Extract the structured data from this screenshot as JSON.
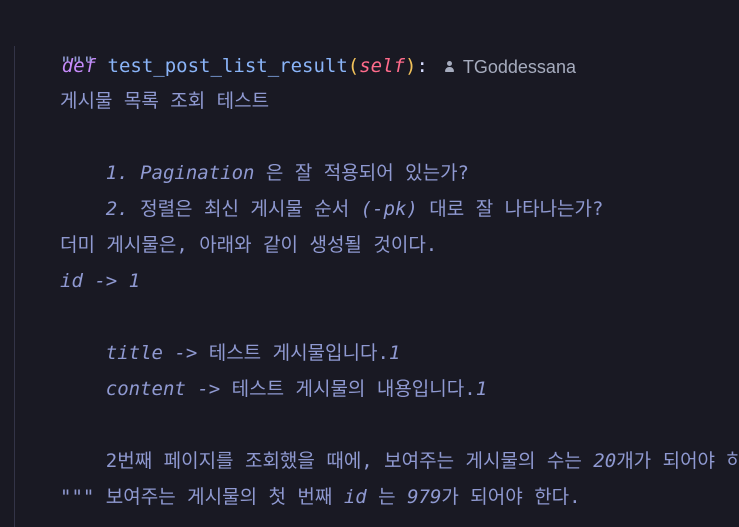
{
  "code": {
    "keyword": "def",
    "function_name": "test_post_list_result",
    "open_paren": "(",
    "param": "self",
    "close_paren": ")",
    "colon": ":",
    "author": "TGoddessana",
    "doc_open": "\"\"\"",
    "doc_title": "게시물 목록 조회 테스트",
    "doc_line1_prefix": "1. Pagination ",
    "doc_line1_rest": "은 잘 적용되어 있는가?",
    "doc_line2_prefix": "2. ",
    "doc_line2_mid": "정렬은 최신 게시물 순서 ",
    "doc_line2_pk": "(-pk) ",
    "doc_line2_end": "대로 잘 나타나는가?",
    "dummy_intro": "더미 게시물은, 아래와 같이 생성될 것이다.",
    "id_line": "id -> 1",
    "title_prefix": "title -> ",
    "title_text": "테스트 게시물입니다.",
    "title_suffix": "1",
    "content_prefix": "content -> ",
    "content_text": "테스트 게시물의 내용입니다.",
    "content_suffix": "1",
    "page2_a": "2",
    "page2_b": "번째 페이지를 조회했을 때에, 보여주는 게시물의 수는 ",
    "page2_num": "20",
    "page2_c": "개가 되어야 하고,",
    "first_a": "보여주는 게시물의 첫 번째 ",
    "first_id": "id ",
    "first_b": "는 ",
    "first_num": "979",
    "first_c": "가 되어야 한다.",
    "doc_close": "\"\"\""
  }
}
